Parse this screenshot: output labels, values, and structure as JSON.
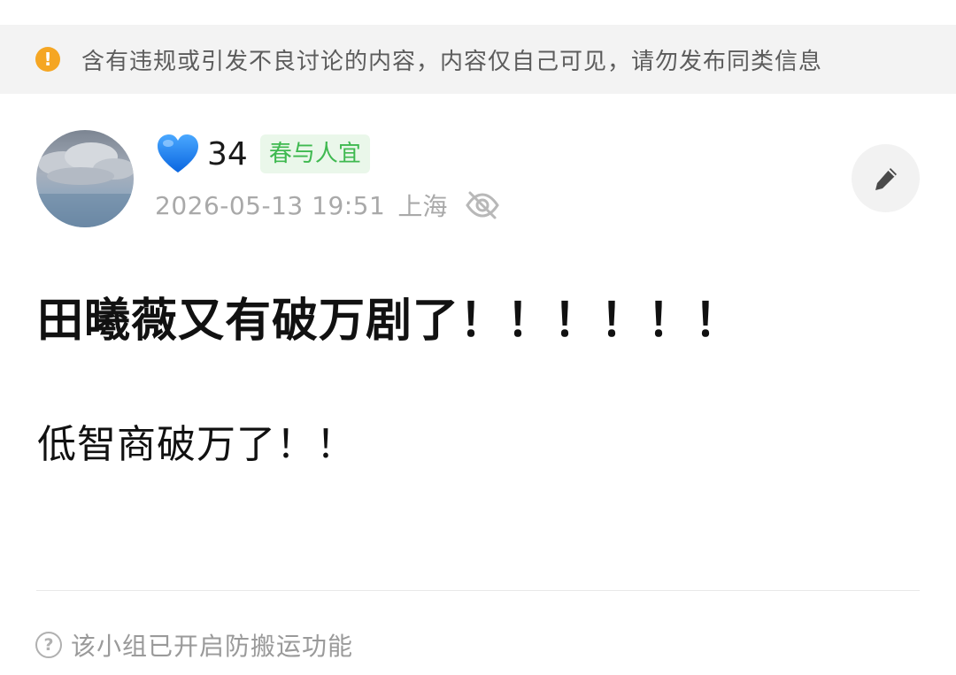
{
  "warning": {
    "icon": "exclamation-icon",
    "icon_glyph": "!",
    "text": "含有违规或引发不良讨论的内容，内容仅自己可见，请勿发布同类信息",
    "accent_color": "#f5a623"
  },
  "author": {
    "avatar": "cloud-sky-avatar",
    "emoji": "blue-heart-icon",
    "nickname": "34",
    "group_badge": "春与人宜",
    "badge_color": "#3fb950"
  },
  "meta": {
    "timestamp": "2026-05-13 19:51",
    "location": "上海",
    "visibility_icon": "eye-off-icon"
  },
  "actions": {
    "edit_icon": "pencil-icon"
  },
  "post": {
    "title": "田曦薇又有破万剧了！！！！！！",
    "body": "低智商破万了！！"
  },
  "footer": {
    "icon": "question-icon",
    "icon_glyph": "?",
    "text": "该小组已开启防搬运功能"
  }
}
